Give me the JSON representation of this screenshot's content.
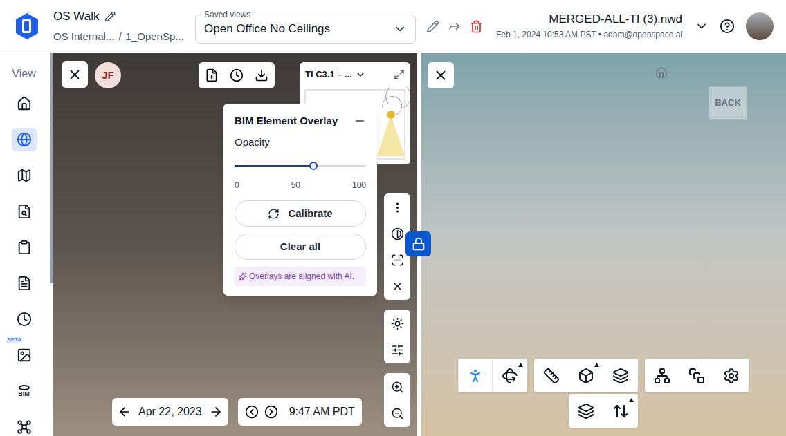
{
  "header": {
    "project": "OS Walk",
    "breadcrumb": [
      "OS Internal...",
      "1_OpenSp..."
    ],
    "breadcrumb_separator": "/",
    "saved_views": {
      "label": "Saved views",
      "value": "Open Office No Ceilings"
    },
    "model": {
      "name": "MERGED-ALL-TI (3).nwd",
      "meta": "Feb 1, 2024 10:53 AM PST • adam@openspace.ai"
    }
  },
  "sidebar": {
    "label": "View",
    "items": [
      {
        "selected": false
      },
      {
        "selected": true
      },
      {
        "selected": false
      },
      {
        "selected": false
      },
      {
        "selected": false
      },
      {
        "selected": false
      },
      {
        "selected": false
      },
      {
        "selected": false,
        "badge": "BETA"
      },
      {
        "selected": false,
        "text": "BIM"
      },
      {
        "selected": false
      }
    ]
  },
  "viewer": {
    "user_initials": "JF",
    "sheet": "TI C3.1 – ...",
    "overlay_panel": {
      "title": "BIM Element Overlay",
      "opacity_label": "Opacity",
      "level": 0.6,
      "ticks": [
        "0",
        "50",
        "100"
      ],
      "buttons": [
        "Calibrate",
        "Clear all"
      ],
      "note": "Overlays are aligned with AI."
    },
    "date": "Apr 22, 2023",
    "time": "9:47 AM PDT",
    "sync_locked": true
  },
  "model_viewer": {
    "view_cube": "BACK",
    "toolbar_rows": [
      [
        [
          {
            "selected": true,
            "flyout": false
          },
          {
            "selected": false,
            "flyout": true
          }
        ],
        [
          {
            "selected": false,
            "flyout": false
          },
          {
            "selected": false,
            "flyout": true
          },
          {
            "selected": false,
            "flyout": false
          }
        ],
        [
          {
            "selected": false,
            "flyout": false
          },
          {
            "selected": false,
            "flyout": false
          },
          {
            "selected": false,
            "flyout": false
          }
        ]
      ],
      [
        [
          {
            "selected": false,
            "flyout": false
          },
          {
            "selected": false,
            "flyout": true
          }
        ]
      ]
    ]
  }
}
